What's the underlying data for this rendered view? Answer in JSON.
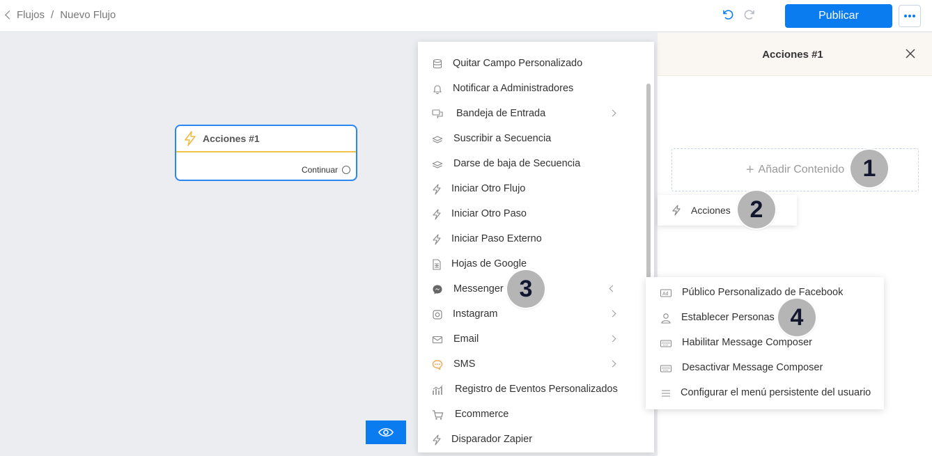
{
  "breadcrumb": {
    "parent": "Flujos",
    "separator": "/",
    "current": "Nuevo Flujo"
  },
  "toolbar": {
    "publish_label": "Publicar"
  },
  "node": {
    "title": "Acciones #1",
    "continue_label": "Continuar"
  },
  "panel": {
    "title": "Acciones #1",
    "add_content": "Añadir Contenido",
    "actions_popup": "Acciones"
  },
  "menu": {
    "items": [
      {
        "label": "Quitar Campo Personalizado",
        "icon": "database-icon"
      },
      {
        "label": "Notificar a Administradores",
        "icon": "bell-icon"
      },
      {
        "label": "Bandeja de Entrada",
        "icon": "chat-bubbles-icon",
        "submenu": true
      },
      {
        "label": "Suscribir a Secuencia",
        "icon": "layers-icon"
      },
      {
        "label": "Darse de baja de Secuencia",
        "icon": "layers-icon"
      },
      {
        "label": "Iniciar Otro Flujo",
        "icon": "lightning-icon"
      },
      {
        "label": "Iniciar Otro Paso",
        "icon": "lightning-icon"
      },
      {
        "label": "Iniciar Paso Externo",
        "icon": "lightning-icon"
      },
      {
        "label": "Hojas de Google",
        "icon": "sheet-icon"
      },
      {
        "label": "Messenger",
        "icon": "messenger-icon",
        "submenu": true
      },
      {
        "label": "Instagram",
        "icon": "instagram-icon",
        "submenu": true
      },
      {
        "label": "Email",
        "icon": "envelope-icon",
        "submenu": true
      },
      {
        "label": "SMS",
        "icon": "sms-icon",
        "submenu": true
      },
      {
        "label": "Registro de Eventos Personalizados",
        "icon": "chart-icon"
      },
      {
        "label": "Ecommerce",
        "icon": "cart-icon"
      },
      {
        "label": "Disparador Zapier",
        "icon": "lightning-icon"
      }
    ]
  },
  "submenu": {
    "items": [
      {
        "label": "Público Personalizado de Facebook",
        "icon": "ad-icon"
      },
      {
        "label": "Establecer Personas",
        "icon": "person-icon"
      },
      {
        "label": "Habilitar Message Composer",
        "icon": "keyboard-icon"
      },
      {
        "label": "Desactivar Message Composer",
        "icon": "keyboard-icon"
      },
      {
        "label": "Configurar el menú persistente del usuario",
        "icon": "menu-lines-icon"
      }
    ]
  },
  "annotations": [
    "1",
    "2",
    "3",
    "4"
  ],
  "colors": {
    "accent": "#0b7bf0",
    "node_border": "#2a86f1",
    "node_divider": "#f0c24a",
    "badge": "#b5b5b5"
  }
}
